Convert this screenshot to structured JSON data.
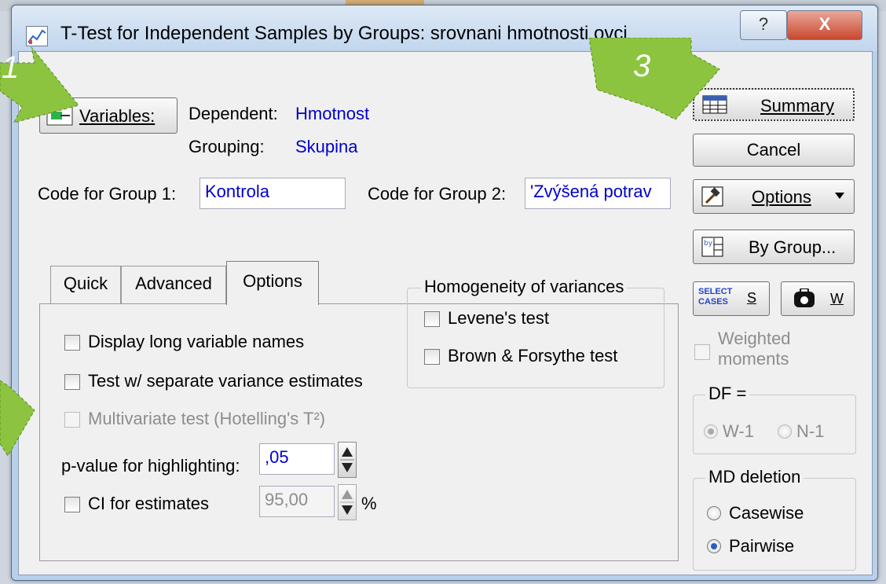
{
  "window": {
    "title": "T-Test for Independent Samples by Groups: srovnani hmotnosti ovci",
    "help_label": "?",
    "close_label": "X"
  },
  "variables": {
    "button_label": "Variables:",
    "dependent_label": "Dependent:",
    "dependent_value": "Hmotnost",
    "grouping_label": "Grouping:",
    "grouping_value": "Skupina"
  },
  "codes": {
    "group1_label": "Code for Group 1:",
    "group1_value": "Kontrola",
    "group2_label": "Code for Group 2:",
    "group2_value": "'Zvýšená potrav"
  },
  "tabs": [
    {
      "label": "Quick"
    },
    {
      "label": "Advanced"
    },
    {
      "label": "Options",
      "active": true
    }
  ],
  "options": {
    "long_names": "Display long variable names",
    "separate_variance": "Test w/ separate variance estimates",
    "multivariate": "Multivariate test (Hotelling's T²)",
    "pvalue_label": "p-value for highlighting:",
    "pvalue_value": ",05",
    "ci_label": "CI for estimates",
    "ci_value": "95,00",
    "ci_unit": "%"
  },
  "homogeneity": {
    "title": "Homogeneity of variances",
    "levene": "Levene's test",
    "brown": "Brown & Forsythe test"
  },
  "side": {
    "summary": "Summary",
    "cancel": "Cancel",
    "options": "Options",
    "bygroup": "By Group...",
    "select_cases": "SELECT CASES",
    "select_s": "S",
    "weight_w": "W",
    "weighted_moments": "Weighted moments",
    "df_title": "DF =",
    "df_w1": "W-1",
    "df_n1": "N-1",
    "md_title": "MD deletion",
    "md_casewise": "Casewise",
    "md_pairwise": "Pairwise"
  },
  "annotations": {
    "arrow1": "1",
    "arrow3": "3"
  },
  "colors": {
    "accent_blue": "#0000cc",
    "arrow_green": "#8cc43f"
  }
}
